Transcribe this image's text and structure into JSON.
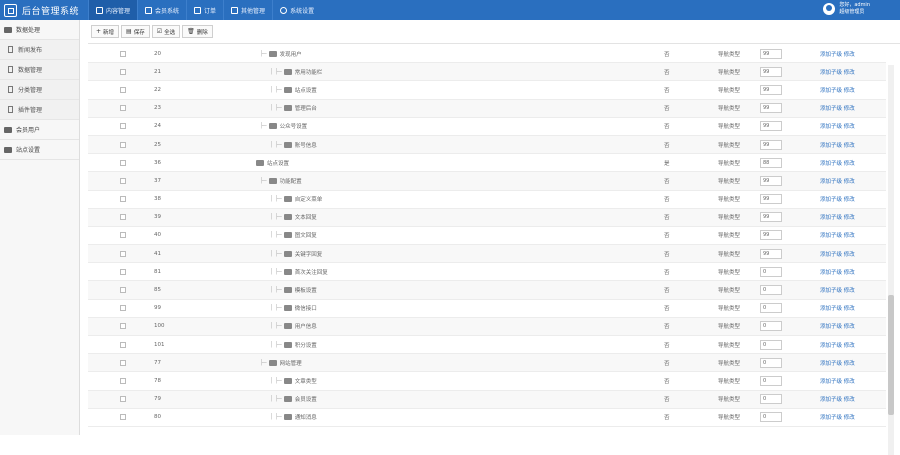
{
  "app": {
    "title": "后台管理系统"
  },
  "nav": [
    {
      "label": "内容管理",
      "icon": "monitor-icon"
    },
    {
      "label": "会员系统",
      "icon": "user-icon"
    },
    {
      "label": "订单",
      "icon": "card-icon"
    },
    {
      "label": "其他管理",
      "icon": "puzzle-icon"
    },
    {
      "label": "系统设置",
      "icon": "gear-icon"
    }
  ],
  "user": {
    "line1": "您好，admin",
    "line2": "超级管理员"
  },
  "sidebar": {
    "groups": [
      {
        "label": "数据处理"
      },
      {
        "label": "会员用户"
      },
      {
        "label": "站点设置"
      }
    ],
    "items": [
      {
        "label": "新闻发布"
      },
      {
        "label": "数据管理"
      },
      {
        "label": "分类管理"
      },
      {
        "label": "插件管理"
      }
    ]
  },
  "toolbar": {
    "add": "新增",
    "save": "保存",
    "select_all": "全选",
    "delete": "删除"
  },
  "ops": {
    "add_child": "添加子级",
    "modify": "修改"
  },
  "rows": [
    {
      "id": "20",
      "name": "发现用户",
      "flag": "否",
      "type": "导航类型",
      "sort": "99",
      "indent": 1
    },
    {
      "id": "21",
      "name": "常用功能栏",
      "flag": "否",
      "type": "导航类型",
      "sort": "99",
      "indent": 2
    },
    {
      "id": "22",
      "name": "站点设置",
      "flag": "否",
      "type": "导航类型",
      "sort": "99",
      "indent": 2
    },
    {
      "id": "23",
      "name": "管理后台",
      "flag": "否",
      "type": "导航类型",
      "sort": "99",
      "indent": 2
    },
    {
      "id": "24",
      "name": "公众号设置",
      "flag": "否",
      "type": "导航类型",
      "sort": "99",
      "indent": 1
    },
    {
      "id": "25",
      "name": "账号信息",
      "flag": "否",
      "type": "导航类型",
      "sort": "99",
      "indent": 2
    },
    {
      "id": "36",
      "name": "站点设置",
      "flag": "是",
      "type": "导航类型",
      "sort": "88",
      "indent": 0
    },
    {
      "id": "37",
      "name": "功能配置",
      "flag": "否",
      "type": "导航类型",
      "sort": "99",
      "indent": 1
    },
    {
      "id": "38",
      "name": "自定义菜单",
      "flag": "否",
      "type": "导航类型",
      "sort": "99",
      "indent": 2
    },
    {
      "id": "39",
      "name": "文本回复",
      "flag": "否",
      "type": "导航类型",
      "sort": "99",
      "indent": 2
    },
    {
      "id": "40",
      "name": "图文回复",
      "flag": "否",
      "type": "导航类型",
      "sort": "99",
      "indent": 2
    },
    {
      "id": "41",
      "name": "关键字回复",
      "flag": "否",
      "type": "导航类型",
      "sort": "99",
      "indent": 2
    },
    {
      "id": "81",
      "name": "首次关注回复",
      "flag": "否",
      "type": "导航类型",
      "sort": "0",
      "indent": 2
    },
    {
      "id": "85",
      "name": "模板设置",
      "flag": "否",
      "type": "导航类型",
      "sort": "0",
      "indent": 2
    },
    {
      "id": "99",
      "name": "微信接口",
      "flag": "否",
      "type": "导航类型",
      "sort": "0",
      "indent": 2
    },
    {
      "id": "100",
      "name": "用户信息",
      "flag": "否",
      "type": "导航类型",
      "sort": "0",
      "indent": 2
    },
    {
      "id": "101",
      "name": "积分设置",
      "flag": "否",
      "type": "导航类型",
      "sort": "0",
      "indent": 2
    },
    {
      "id": "77",
      "name": "网站管理",
      "flag": "否",
      "type": "导航类型",
      "sort": "0",
      "indent": 1
    },
    {
      "id": "78",
      "name": "文章类型",
      "flag": "否",
      "type": "导航类型",
      "sort": "0",
      "indent": 2
    },
    {
      "id": "79",
      "name": "会员设置",
      "flag": "否",
      "type": "导航类型",
      "sort": "0",
      "indent": 2
    },
    {
      "id": "80",
      "name": "通知消息",
      "flag": "否",
      "type": "导航类型",
      "sort": "0",
      "indent": 2
    }
  ]
}
